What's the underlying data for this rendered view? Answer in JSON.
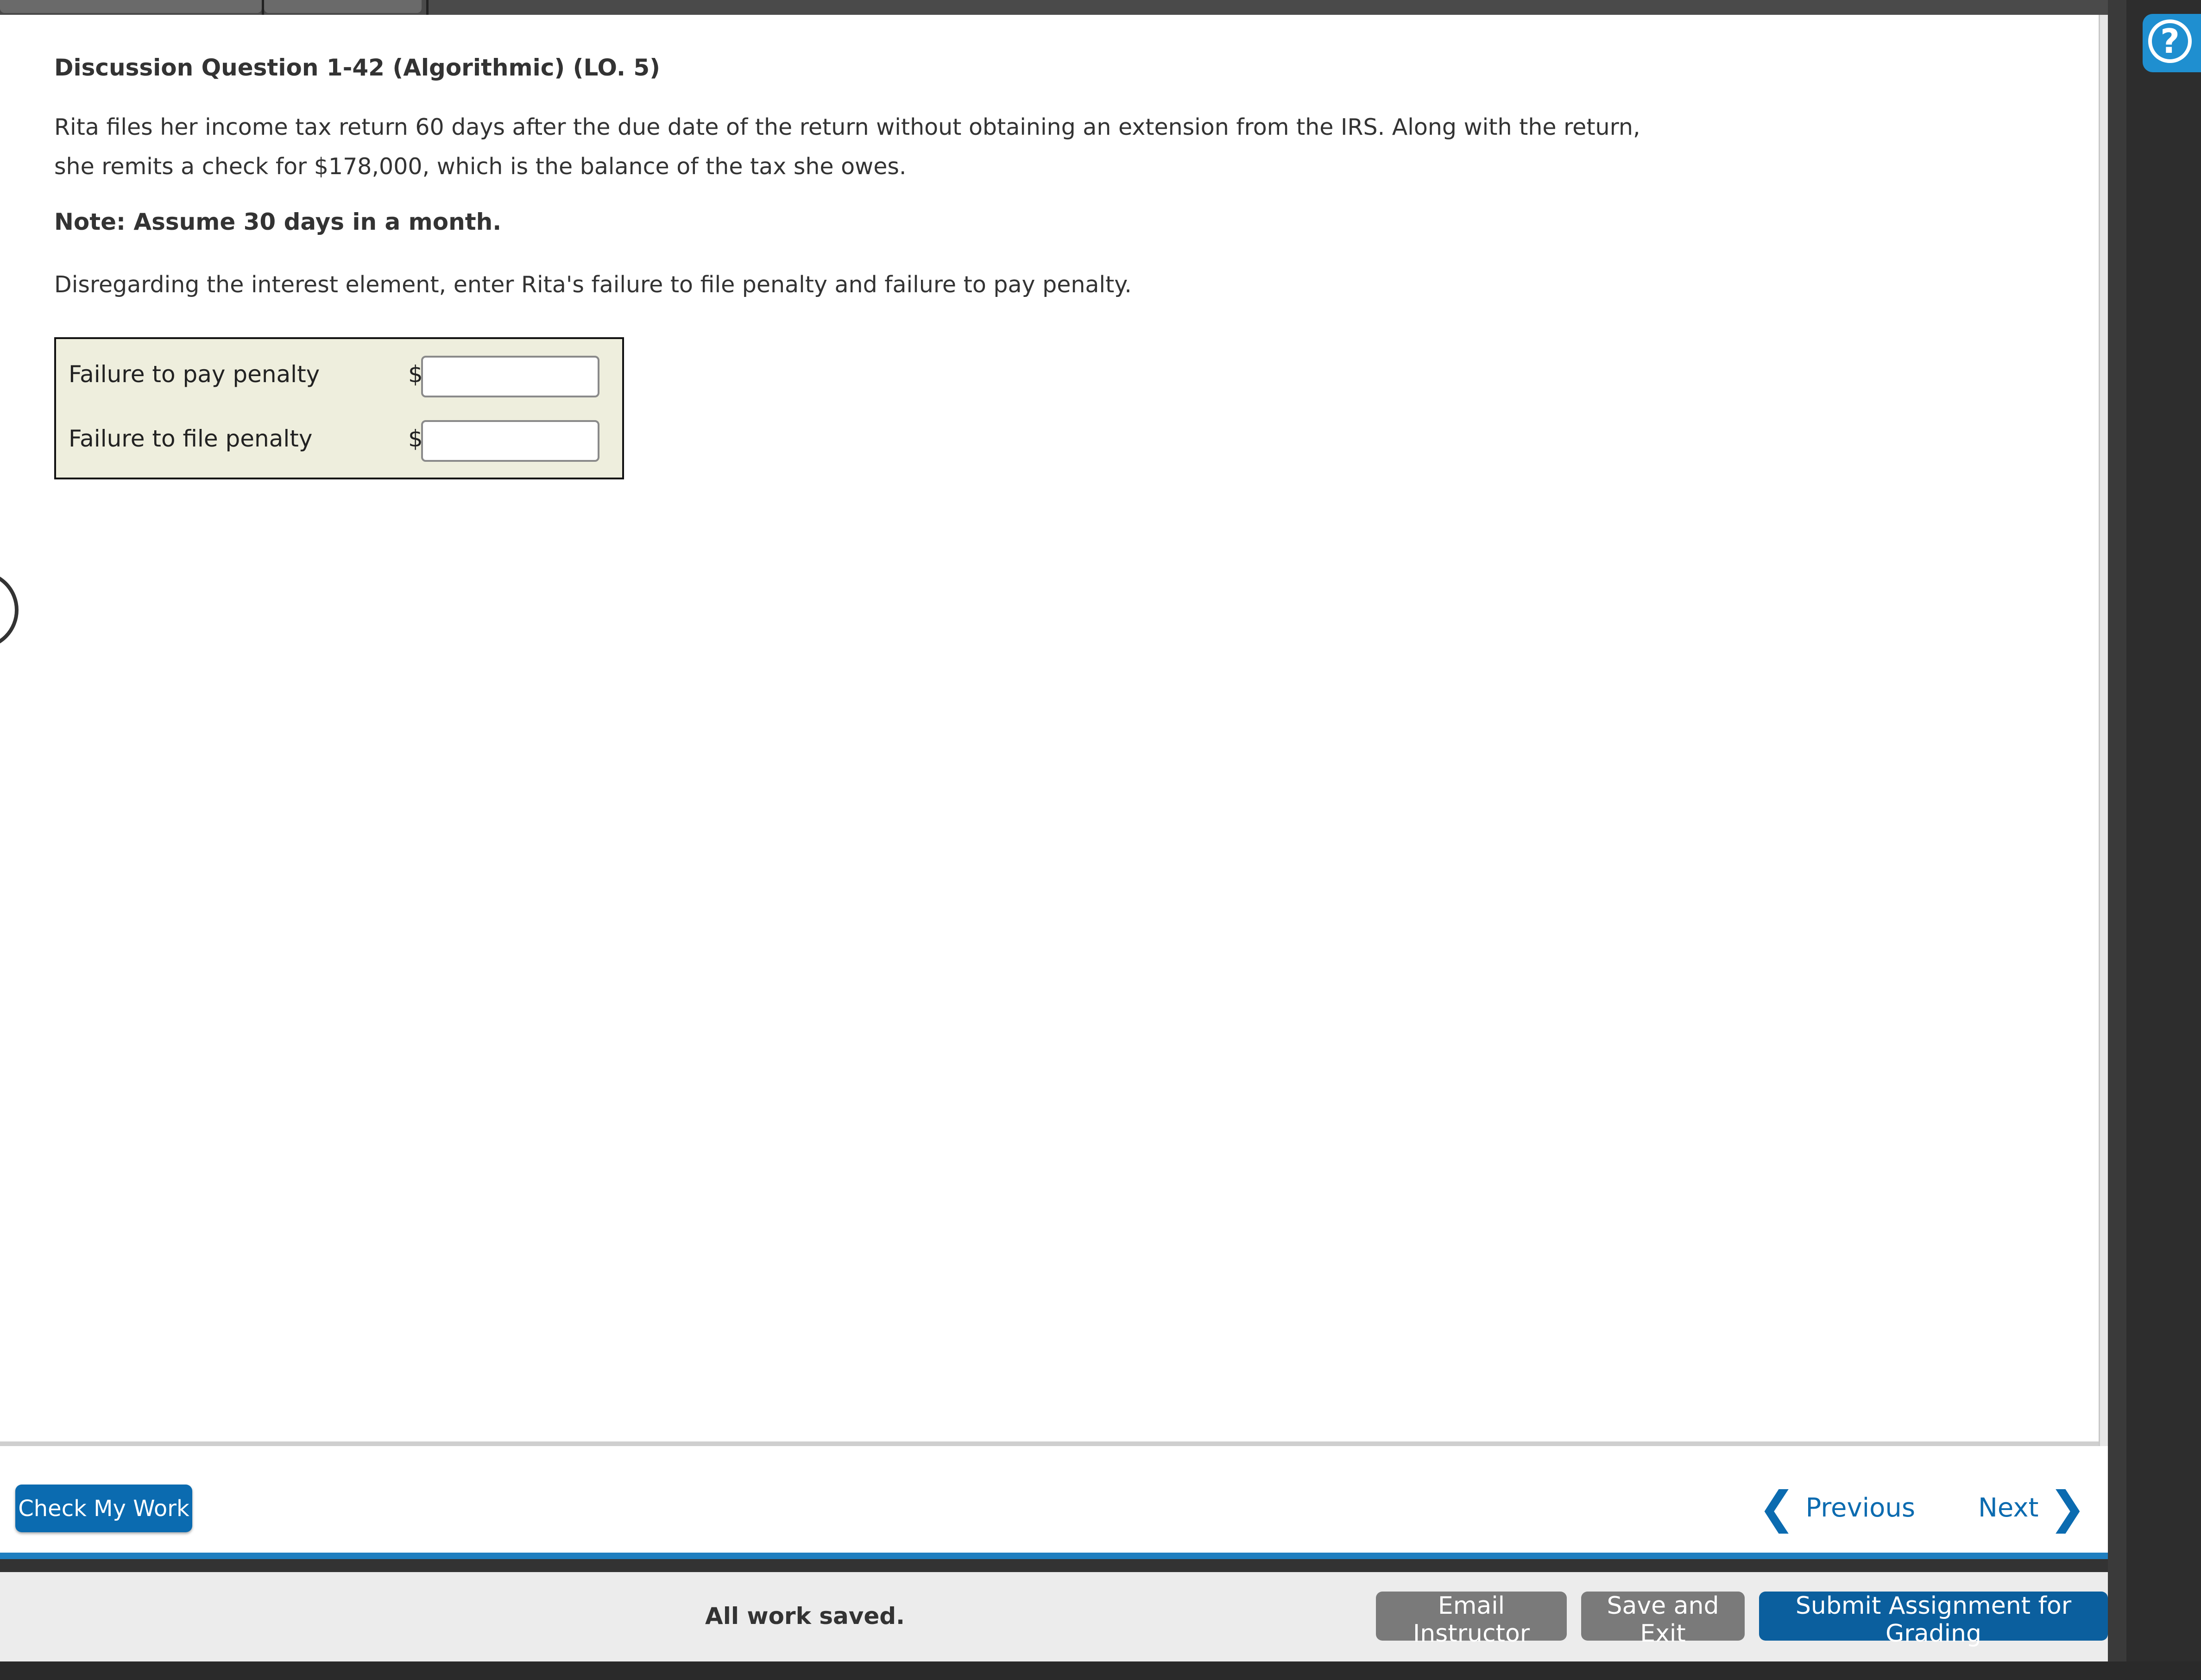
{
  "question": {
    "title": "Discussion Question 1-42 (Algorithmic) (LO. 5)",
    "paragraph1": "Rita files her income tax return 60 days after the due date of the return without obtaining an extension from the IRS. Along with the return, she remits a check for $178,000, which is the balance of the tax she owes.",
    "note": "Note: Assume 30 days in a month.",
    "paragraph2": "Disregarding the interest element, enter Rita's failure to file penalty and failure to pay penalty."
  },
  "answer": {
    "rows": [
      {
        "label": "Failure to pay penalty",
        "currency": "$",
        "value": ""
      },
      {
        "label": "Failure to file penalty",
        "currency": "$",
        "value": ""
      }
    ]
  },
  "nav": {
    "check_label": "Check My Work",
    "previous_label": "Previous",
    "next_label": "Next"
  },
  "footer": {
    "status": "All work saved.",
    "email_label": "Email Instructor",
    "save_label": "Save and Exit",
    "submit_label": "Submit Assignment for Grading"
  },
  "help": {
    "glyph": "?"
  },
  "colors": {
    "accent": "#0b6bb0",
    "help": "#1f8fd0",
    "answer_bg": "#eeeedd",
    "secondary_button": "#7a7a7a"
  }
}
